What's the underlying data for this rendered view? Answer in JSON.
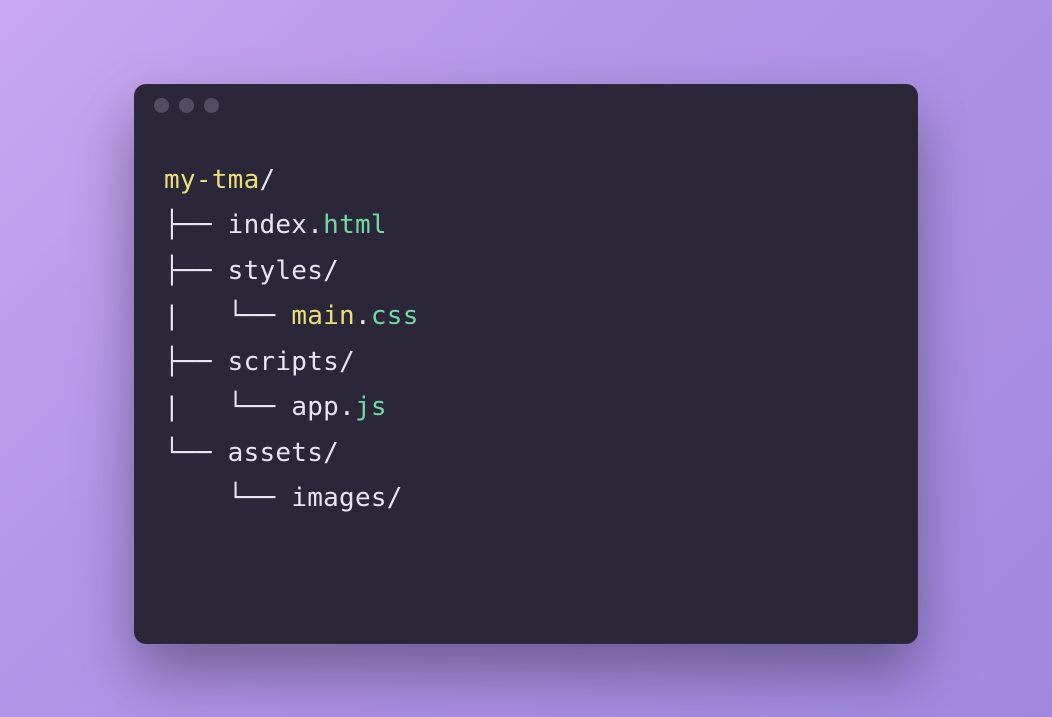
{
  "tree": {
    "root": "my-tma",
    "slash": "/",
    "branchT": "├── ",
    "branchL": "└── ",
    "pipe": "|   ",
    "indent": "    ",
    "line1_name": "index",
    "line1_dot": ".",
    "line1_ext": "html",
    "line2_name": "styles",
    "line3_name": "main",
    "line3_dot": ".",
    "line3_ext": "css",
    "line4_name": "scripts",
    "line5_name": "app",
    "line5_dot": ".",
    "line5_ext": "js",
    "line6_name": "assets",
    "line7_name": "images"
  }
}
